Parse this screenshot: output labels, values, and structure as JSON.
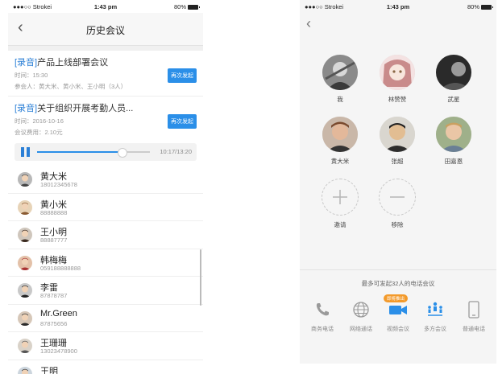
{
  "status": {
    "carrier": "●●●○○ Strokei",
    "time": "1:43 pm",
    "battery": "80%"
  },
  "left": {
    "back_icon": "chevron-left-icon",
    "title": "历史会议",
    "meetings": [
      {
        "tag": "[录音]",
        "title": "产品上线部署会议",
        "line1": "时间：15:30",
        "line2": "参会人：黄大米、黄小米、王小明（3人）",
        "button": "再次发起"
      },
      {
        "tag": "[录音]",
        "title": "关于组织开展考勤人员...",
        "line1": "时间：2016-10-16",
        "line2": "会议费用：2.10元",
        "button": "再次发起"
      }
    ],
    "player": {
      "time": "10:17/13:20",
      "progress": 0.75
    },
    "contacts": [
      {
        "name": "黄大米",
        "phone": "18012345678"
      },
      {
        "name": "黄小米",
        "phone": "88888888"
      },
      {
        "name": "王小明",
        "phone": "88887777"
      },
      {
        "name": "韩梅梅",
        "phone": "059188888888"
      },
      {
        "name": "李雷",
        "phone": "87878787"
      },
      {
        "name": "Mr.Green",
        "phone": "87875656"
      },
      {
        "name": "王珊珊",
        "phone": "13023478900"
      },
      {
        "name": "王明",
        "phone": "18900002345"
      }
    ]
  },
  "right": {
    "back_icon": "chevron-left-icon",
    "members": [
      {
        "name": "我"
      },
      {
        "name": "林赞赞"
      },
      {
        "name": "武星"
      },
      {
        "name": "黄大米"
      },
      {
        "name": "张超"
      },
      {
        "name": "田嘉恩"
      }
    ],
    "invite_label": "邀请",
    "remove_label": "移除",
    "hint": "最多可发起32人的电话会议",
    "badge": "即将推出",
    "tabs": [
      {
        "label": "商务电话",
        "icon": "phone-icon"
      },
      {
        "label": "网络通话",
        "icon": "globe-icon"
      },
      {
        "label": "视频会议",
        "icon": "video-camera-icon"
      },
      {
        "label": "多方会议",
        "icon": "multi-party-icon"
      },
      {
        "label": "普通电话",
        "icon": "mobile-phone-icon"
      }
    ],
    "accent": "#2b8fe8"
  }
}
